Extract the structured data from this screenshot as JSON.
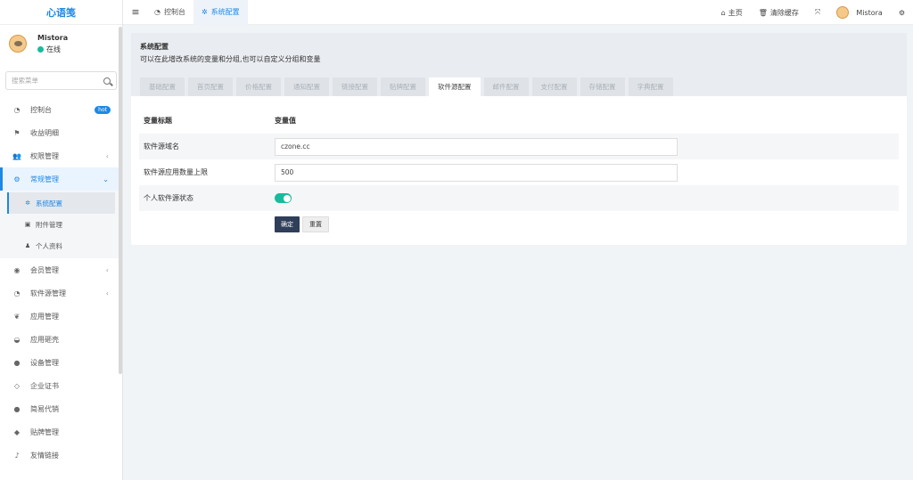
{
  "app": {
    "logo": "心语笺"
  },
  "user": {
    "name": "Mistora",
    "status": "在线"
  },
  "search": {
    "placeholder": "搜索菜单"
  },
  "menu": [
    {
      "icon": "dashboard-icon",
      "glyph": "◔",
      "label": "控制台",
      "badge": "hot"
    },
    {
      "icon": "flag-icon",
      "glyph": "⚑",
      "label": "收益明细"
    },
    {
      "icon": "users-icon",
      "glyph": "👥",
      "label": "权限管理",
      "arrow": "‹"
    },
    {
      "icon": "cogs-icon",
      "glyph": "⚙",
      "label": "常规管理",
      "arrow": "⌄"
    },
    {
      "icon": "user-circle-icon",
      "glyph": "◉",
      "label": "会员管理",
      "arrow": "‹"
    },
    {
      "icon": "dashboard-icon",
      "glyph": "◔",
      "label": "软件源管理",
      "arrow": "‹"
    },
    {
      "icon": "leaf-icon",
      "glyph": "❦",
      "label": "应用管理"
    },
    {
      "icon": "shell-icon",
      "glyph": "◒",
      "label": "应用砸壳"
    },
    {
      "icon": "device-icon",
      "glyph": "●",
      "label": "设备管理"
    },
    {
      "icon": "diamond-icon",
      "glyph": "◇",
      "label": "企业证书"
    },
    {
      "icon": "comment-icon",
      "glyph": "●",
      "label": "简易代销"
    },
    {
      "icon": "tag-icon",
      "glyph": "◆",
      "label": "贴牌管理"
    },
    {
      "icon": "link-icon",
      "glyph": "♪",
      "label": "友情链接"
    }
  ],
  "submenu": [
    {
      "icon": "cog-icon",
      "glyph": "✲",
      "label": "系统配置"
    },
    {
      "icon": "file-image-icon",
      "glyph": "▣",
      "label": "附件管理"
    },
    {
      "icon": "user-icon",
      "glyph": "♟",
      "label": "个人资料"
    }
  ],
  "topbar": {
    "tabs": [
      {
        "icon": "dashboard-icon",
        "glyph": "◔",
        "label": "控制台"
      },
      {
        "icon": "cog-icon",
        "glyph": "✲",
        "label": "系统配置"
      }
    ],
    "home": "主页",
    "clear_cache": "清除缓存",
    "username": "Mistora"
  },
  "panel": {
    "title": "系统配置",
    "desc": "可以在此增改系统的变量和分组,也可以自定义分组和变量",
    "tabs": [
      "基础配置",
      "首页配置",
      "价格配置",
      "通知配置",
      "链接配置",
      "贴牌配置",
      "软件源配置",
      "邮件配置",
      "支付配置",
      "存储配置",
      "字典配置"
    ],
    "active_tab": 6,
    "header": {
      "label": "变量标题",
      "value": "变量值"
    },
    "rows": [
      {
        "label": "软件源域名",
        "value": "czone.cc"
      },
      {
        "label": "软件源应用数量上限",
        "value": "500"
      },
      {
        "label": "个人软件源状态",
        "toggle": true
      }
    ],
    "confirm": "确定",
    "reset": "重置"
  },
  "colors": {
    "accent": "#1e88e5",
    "success": "#18bc9c",
    "primary_button": "#2f3e59"
  }
}
